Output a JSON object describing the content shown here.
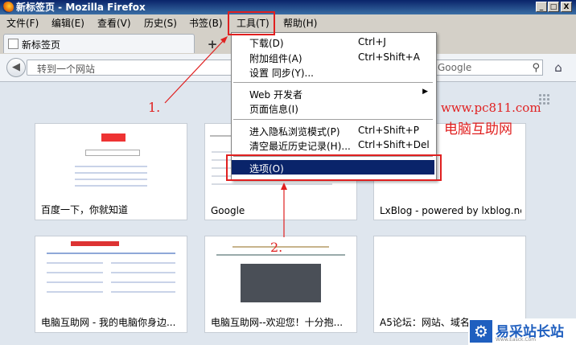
{
  "window": {
    "title": "新标签页 - Mozilla Firefox",
    "min": "_",
    "max": "□",
    "close": "X"
  },
  "menubar": [
    "文件(F)",
    "编辑(E)",
    "查看(V)",
    "历史(S)",
    "书签(B)",
    "工具(T)",
    "帮助(H)"
  ],
  "tab": {
    "label": "新标签页",
    "new_tab": "+"
  },
  "nav": {
    "url_placeholder": "转到一个网站",
    "search_engine": "Google"
  },
  "tools_menu": [
    {
      "label": "下载(D)",
      "key": "Ctrl+J"
    },
    {
      "label": "附加组件(A)",
      "key": "Ctrl+Shift+A"
    },
    {
      "label": "设置 同步(Y)...",
      "key": ""
    },
    {
      "label": "Web 开发者",
      "key": ""
    },
    {
      "label": "页面信息(I)",
      "key": ""
    },
    {
      "label": "进入隐私浏览模式(P)",
      "key": "Ctrl+Shift+P"
    },
    {
      "label": "清空最近历史记录(H)...",
      "key": "Ctrl+Shift+Del"
    },
    {
      "label": "选项(O)",
      "key": ""
    }
  ],
  "thumbnails": [
    "百度一下，你就知道",
    "Google",
    "LxBlog - powered by lxblog.net",
    "电脑互助网 - 我的电脑你身边...",
    "电脑互助网--欢迎您！十分抱...",
    "A5论坛：网站、域名"
  ],
  "annotations": {
    "step1": "1.",
    "step2": "2."
  },
  "watermark": {
    "url": "www.pc811.com",
    "name": "电脑互助网"
  },
  "corner_logo": {
    "text": "易采站长站",
    "sub": "Www.Easck.Com"
  },
  "colors": {
    "highlight": "#0a246a",
    "annotation": "#e02020"
  }
}
